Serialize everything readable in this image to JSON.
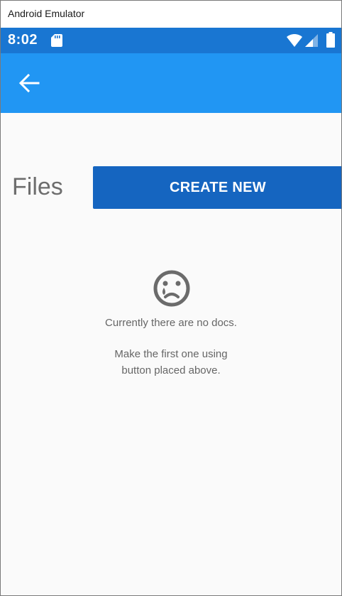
{
  "window": {
    "title": "Android Emulator"
  },
  "status_bar": {
    "time": "8:02",
    "icons": [
      "sd-card-icon",
      "wifi-icon",
      "signal-icon",
      "battery-icon"
    ],
    "color": "#1976d2"
  },
  "app_bar": {
    "back_icon": "arrow-left-icon",
    "color": "#2196f3"
  },
  "header": {
    "title": "Files",
    "create_button_label": "CREATE NEW",
    "button_color": "#1565c0"
  },
  "empty_state": {
    "icon": "sad-face-icon",
    "line1": "Currently there are no docs.",
    "line2": "Make the first one using",
    "line3": "button placed above."
  }
}
